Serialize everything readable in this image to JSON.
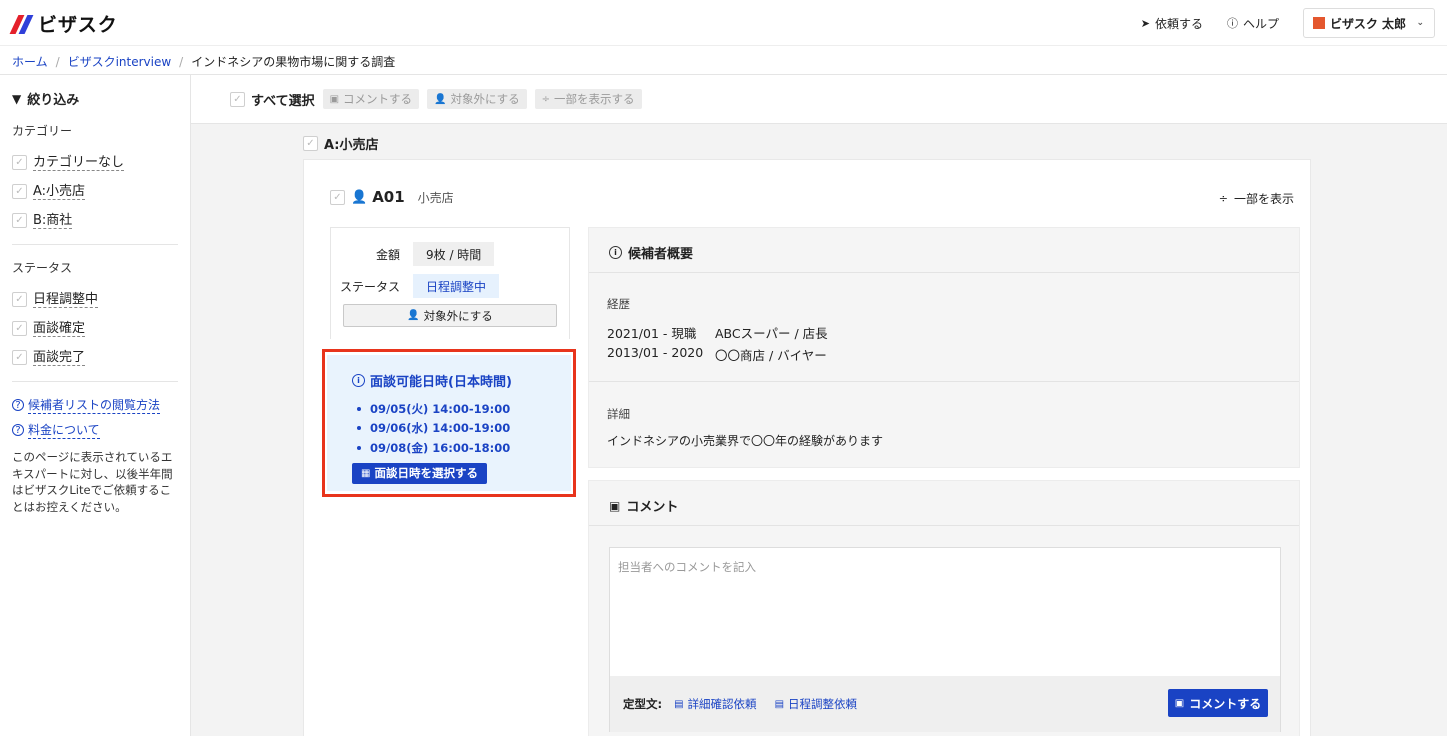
{
  "app": {
    "brand": "ビザスク"
  },
  "header": {
    "request_label": "依頼する",
    "help_label": "ヘルプ",
    "user_name": "ビザスク 太郎"
  },
  "breadcrumb": [
    {
      "label": "ホーム"
    },
    {
      "label": "ビザスクinterview"
    },
    {
      "label": "インドネシアの果物市場に関する調査"
    }
  ],
  "sidebar": {
    "filter_title": "絞り込み",
    "category_heading": "カテゴリー",
    "categories": [
      {
        "label": "カテゴリーなし"
      },
      {
        "label": "A:小売店"
      },
      {
        "label": "B:商社"
      }
    ],
    "status_heading": "ステータス",
    "statuses": [
      {
        "label": "日程調整中"
      },
      {
        "label": "面談確定"
      },
      {
        "label": "面談完了"
      }
    ],
    "links": [
      {
        "label": "候補者リストの閲覧方法"
      },
      {
        "label": "料金について"
      }
    ],
    "note": "このページに表示されているエキスパートに対し、以後半年間はビザスクLiteでご依頼することはお控えください。"
  },
  "toolbar": {
    "select_all": "すべて選択",
    "comment": "コメントする",
    "exclude": "対象外にする",
    "show_partial": "一部を表示する"
  },
  "group": {
    "label": "A:小売店"
  },
  "candidate": {
    "id": "A01",
    "category": "小売店",
    "show_partial": "一部を表示",
    "price_label": "金額",
    "price_value": "9枚 / 時間",
    "status_label": "ステータス",
    "status_value": "日程調整中",
    "exclude_button": "対象外にする"
  },
  "schedule": {
    "title": "面談可能日時(日本時間)",
    "slots": [
      "09/05(火) 14:00-19:00",
      "09/06(水) 14:00-19:00",
      "09/08(金) 16:00-18:00"
    ],
    "select_button": "面談日時を選択する",
    "highlight_color": "#e8341c"
  },
  "overview": {
    "title": "候補者概要",
    "career_heading": "経歴",
    "career": [
      {
        "period": "2021/01 - 現職",
        "desc": "ABCスーパー / 店長"
      },
      {
        "period": "2013/01 - 2020",
        "desc": "〇〇商店 / バイヤー"
      }
    ],
    "detail_heading": "詳細",
    "detail": "インドネシアの小売業界で〇〇年の経験があります"
  },
  "comment": {
    "title": "コメント",
    "placeholder": "担当者へのコメントを記入",
    "value": "",
    "template_label": "定型文:",
    "templates": [
      {
        "label": "詳細確認依頼"
      },
      {
        "label": "日程調整依頼"
      }
    ],
    "submit": "コメントする"
  },
  "colors": {
    "accent": "#1a43c4",
    "status_bg": "#e6f1fd"
  }
}
